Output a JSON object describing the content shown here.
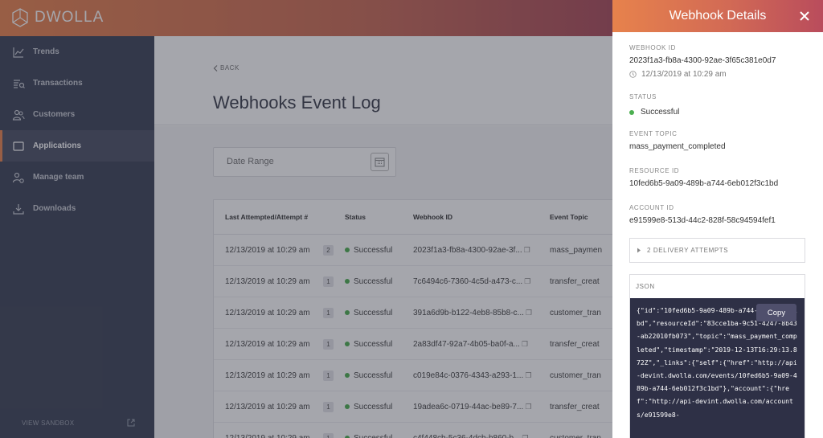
{
  "brand": {
    "name": "DWOLLA"
  },
  "sidebar": {
    "items": [
      {
        "label": "Trends",
        "icon": "trends-icon"
      },
      {
        "label": "Transactions",
        "icon": "transactions-icon"
      },
      {
        "label": "Customers",
        "icon": "customers-icon"
      },
      {
        "label": "Applications",
        "icon": "applications-icon",
        "active": true
      },
      {
        "label": "Manage team",
        "icon": "manage-team-icon"
      },
      {
        "label": "Downloads",
        "icon": "downloads-icon"
      }
    ],
    "sandbox_label": "VIEW SANDBOX"
  },
  "main": {
    "back_label": "BACK",
    "title": "Webhooks Event Log",
    "date_range_placeholder": "Date Range"
  },
  "table": {
    "headers": [
      "Last Attempted/Attempt #",
      "Status",
      "Webhook ID",
      "Event Topic"
    ],
    "rows": [
      {
        "date": "12/13/2019 at 10:29 am",
        "count": "2",
        "status": "Successful",
        "id": "2023f1a3-fb8a-4300-92ae-3f...",
        "topic": "mass_paymen"
      },
      {
        "date": "12/13/2019 at 10:29 am",
        "count": "1",
        "status": "Successful",
        "id": "7c6494c6-7360-4c5d-a473-c...",
        "topic": "transfer_creat"
      },
      {
        "date": "12/13/2019 at 10:29 am",
        "count": "1",
        "status": "Successful",
        "id": "391a6d9b-b122-4eb8-85b8-c...",
        "topic": "customer_tran"
      },
      {
        "date": "12/13/2019 at 10:29 am",
        "count": "1",
        "status": "Successful",
        "id": "2a83df47-92a7-4b05-ba0f-a...",
        "topic": "transfer_creat"
      },
      {
        "date": "12/13/2019 at 10:29 am",
        "count": "1",
        "status": "Successful",
        "id": "c019e84c-0376-4343-a293-1...",
        "topic": "customer_tran"
      },
      {
        "date": "12/13/2019 at 10:29 am",
        "count": "1",
        "status": "Successful",
        "id": "19adea6c-0719-44ac-be89-7...",
        "topic": "transfer_creat"
      },
      {
        "date": "12/13/2019 at 10:29 am",
        "count": "1",
        "status": "Successful",
        "id": "c4f448cb-5c36-4dcb-b860-b...",
        "topic": "customer_tran"
      }
    ]
  },
  "panel": {
    "title": "Webhook Details",
    "webhook_id_label": "WEBHOOK ID",
    "webhook_id": "2023f1a3-fb8a-4300-92ae-3f65c381e0d7",
    "timestamp": "12/13/2019 at 10:29 am",
    "status_label": "STATUS",
    "status": "Successful",
    "event_topic_label": "EVENT TOPIC",
    "event_topic": "mass_payment_completed",
    "resource_id_label": "RESOURCE ID",
    "resource_id": "10fed6b5-9a09-489b-a744-6eb012f3c1bd",
    "account_id_label": "ACCOUNT ID",
    "account_id": "e91599e8-513d-44c2-828f-58c94594fef1",
    "delivery_attempts": "2 DELIVERY ATTEMPTS",
    "json_label": "JSON",
    "json_text": "{\"id\":\"10fed6b5-9a09-489b-a744-6eb012f3c1bd\",\"resourceId\":\"83cce1ba-9c51-4247-8b43-ab22010fb073\",\"topic\":\"mass_payment_completed\",\"timestamp\":\"2019-12-13T16:29:13.872Z\",\"_links\":{\"self\":{\"href\":\"http://api-devint.dwolla.com/events/10fed6b5-9a09-489b-a744-6eb012f3c1bd\"},\"account\":{\"href\":\"http://api-devint.dwolla.com/accounts/e91599e8-",
    "copy_label": "Copy"
  },
  "colors": {
    "success": "#4caf50",
    "accent": "#e9834e",
    "sidebar": "#3c4256"
  }
}
